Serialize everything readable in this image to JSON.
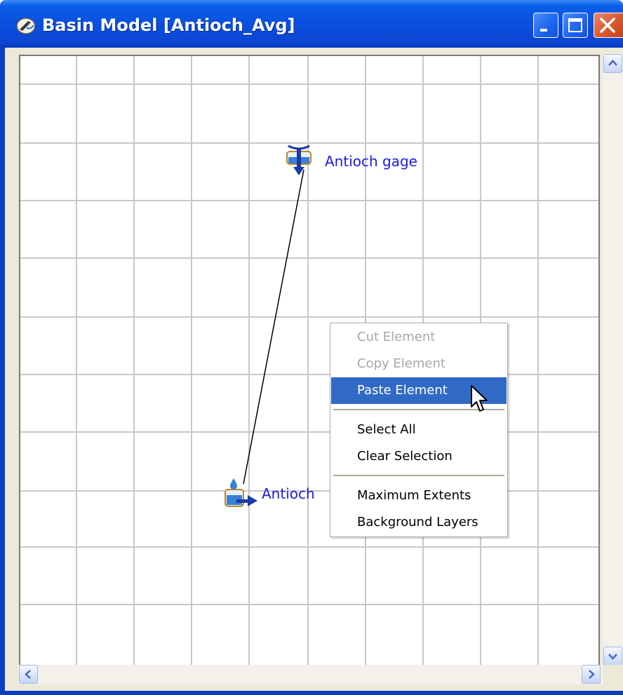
{
  "window": {
    "title": "Basin Model [Antioch_Avg]",
    "icon": "hec-hms-app-icon",
    "controls": [
      "minimize-icon",
      "maximize-icon",
      "close-icon"
    ]
  },
  "canvas": {
    "grid": true,
    "elements": [
      {
        "type": "sink",
        "icon": "sink-gage-icon",
        "label": "Antioch gage"
      },
      {
        "type": "subbasin",
        "icon": "subbasin-icon",
        "label": "Antioch"
      }
    ],
    "connection": {
      "from": "Antioch",
      "to": "Antioch gage"
    }
  },
  "context_menu": {
    "items": [
      {
        "label": "Cut Element",
        "enabled": false
      },
      {
        "label": "Copy Element",
        "enabled": false
      },
      {
        "label": "Paste Element",
        "enabled": true,
        "highlighted": true
      },
      {
        "label": "Select All",
        "enabled": true
      },
      {
        "label": "Clear Selection",
        "enabled": true
      },
      {
        "label": "Maximum Extents",
        "enabled": true
      },
      {
        "label": "Background Layers",
        "enabled": true
      }
    ]
  },
  "colors": {
    "title_bar": "#0a4fdf",
    "highlight": "#316ac5",
    "element_label": "#1a1ae6",
    "disabled_text": "#a7a7a7"
  }
}
